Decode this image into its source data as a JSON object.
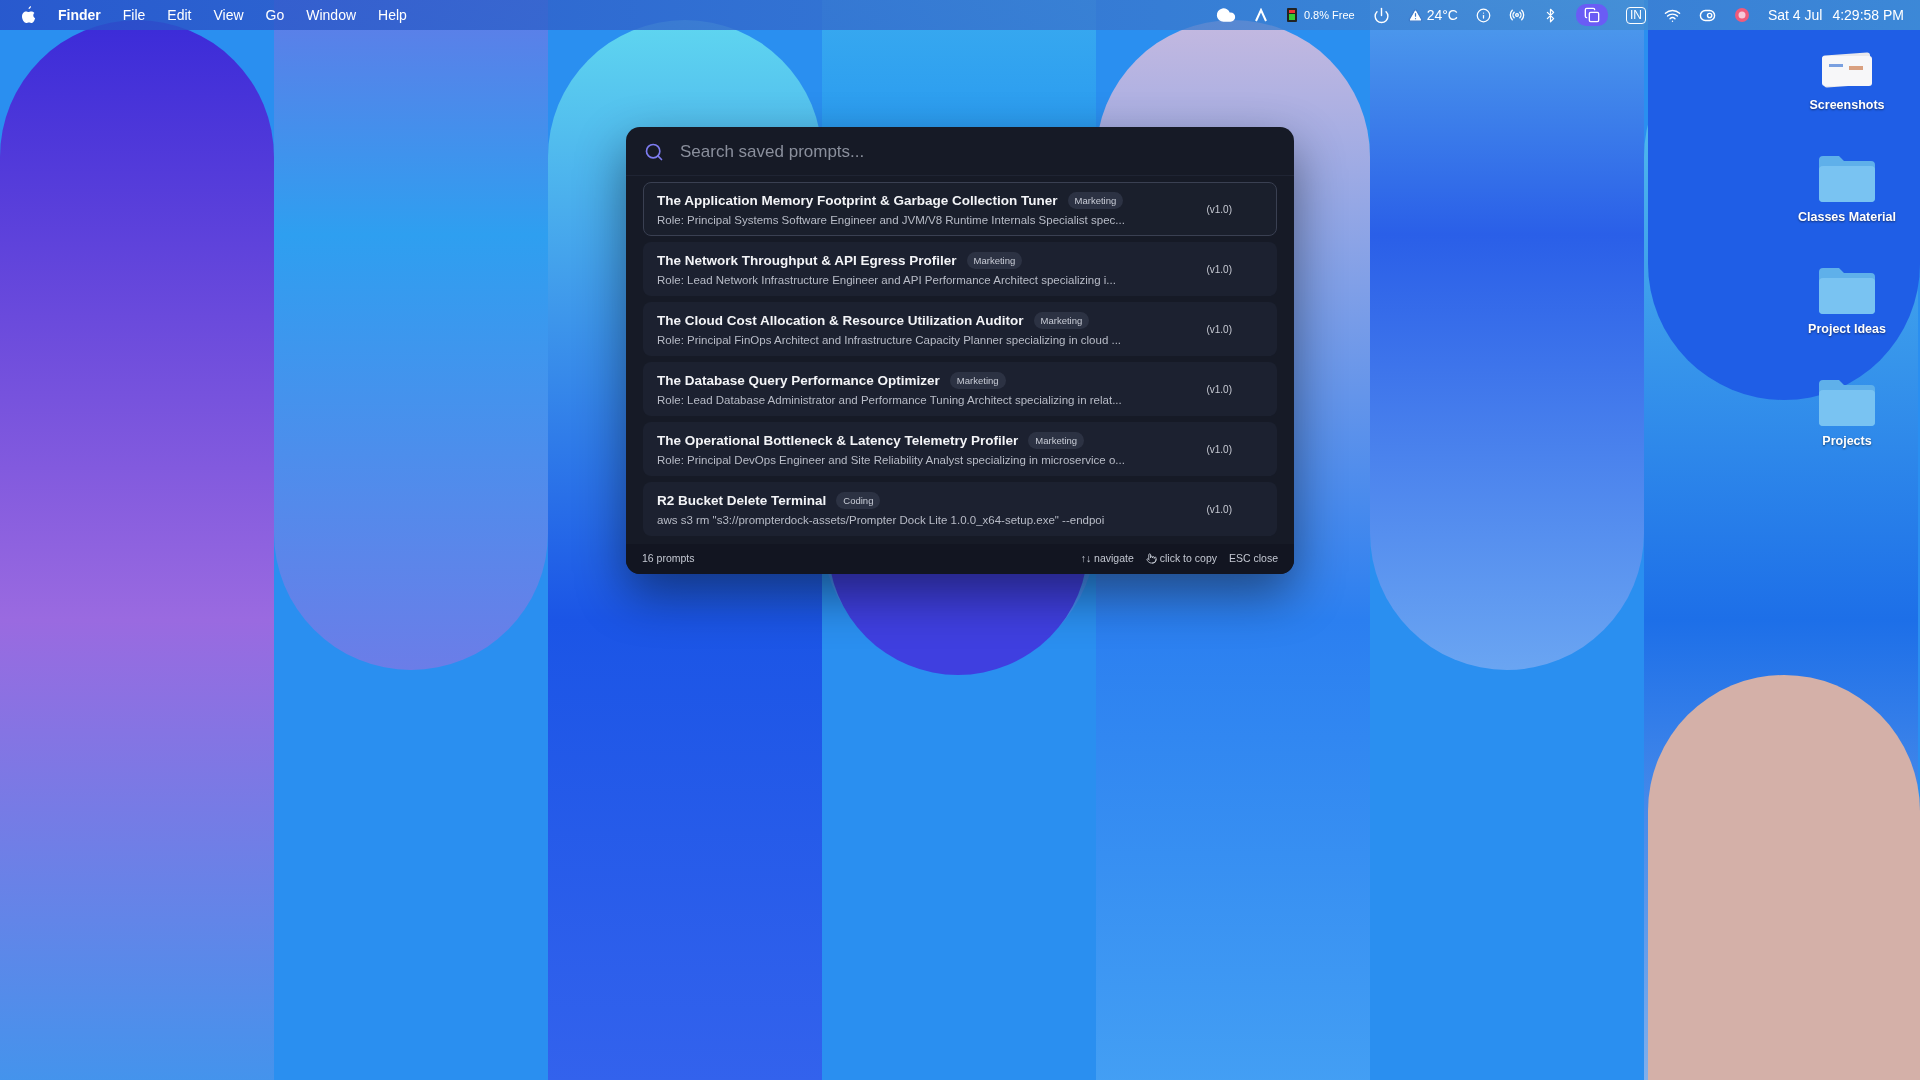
{
  "menu_bar": {
    "app_name": "Finder",
    "menus": [
      "File",
      "Edit",
      "View",
      "Go",
      "Window",
      "Help"
    ],
    "status": {
      "memory": "0.8% Free",
      "temperature": "24°C",
      "input_source": "IN",
      "date": "Sat 4 Jul",
      "time": "4:29:58 PM"
    }
  },
  "desktop": {
    "icons": [
      {
        "label": "Screenshots",
        "kind": "stack"
      },
      {
        "label": "Classes Material",
        "kind": "folder"
      },
      {
        "label": "Project Ideas",
        "kind": "folder"
      },
      {
        "label": "Projects",
        "kind": "folder"
      }
    ]
  },
  "palette": {
    "search": {
      "placeholder": "Search saved prompts..."
    },
    "prompts": [
      {
        "title": "The Application Memory Footprint & Garbage Collection Tuner",
        "tag": "Marketing",
        "description": "Role: Principal Systems Software Engineer and JVM/V8 Runtime Internals Specialist spec...",
        "version": "(v1.0)",
        "selected": true
      },
      {
        "title": "The Network Throughput & API Egress Profiler",
        "tag": "Marketing",
        "description": "Role: Lead Network Infrastructure Engineer and API Performance Architect specializing i...",
        "version": "(v1.0)",
        "selected": false
      },
      {
        "title": "The Cloud Cost Allocation & Resource Utilization Auditor",
        "tag": "Marketing",
        "description": "Role: Principal FinOps Architect and Infrastructure Capacity Planner specializing in cloud ...",
        "version": "(v1.0)",
        "selected": false
      },
      {
        "title": "The Database Query Performance Optimizer",
        "tag": "Marketing",
        "description": "Role: Lead Database Administrator and Performance Tuning Architect specializing in relat...",
        "version": "(v1.0)",
        "selected": false
      },
      {
        "title": "The Operational Bottleneck & Latency Telemetry Profiler",
        "tag": "Marketing",
        "description": "Role: Principal DevOps Engineer and Site Reliability Analyst specializing in microservice o...",
        "version": "(v1.0)",
        "selected": false
      },
      {
        "title": "R2 Bucket Delete Terminal",
        "tag": "Coding",
        "description": "aws s3 rm \"s3://prompterdock-assets/Prompter Dock Lite 1.0.0_x64-setup.exe\" --endpoi",
        "version": "(v1.0)",
        "selected": false
      }
    ],
    "footer": {
      "count": "16 prompts",
      "hints": [
        {
          "keys": "↑↓",
          "label": "navigate",
          "kind": "keys"
        },
        {
          "label": "click to copy",
          "kind": "icon"
        },
        {
          "keys": "ESC",
          "label": "close",
          "kind": "keys"
        }
      ]
    }
  }
}
